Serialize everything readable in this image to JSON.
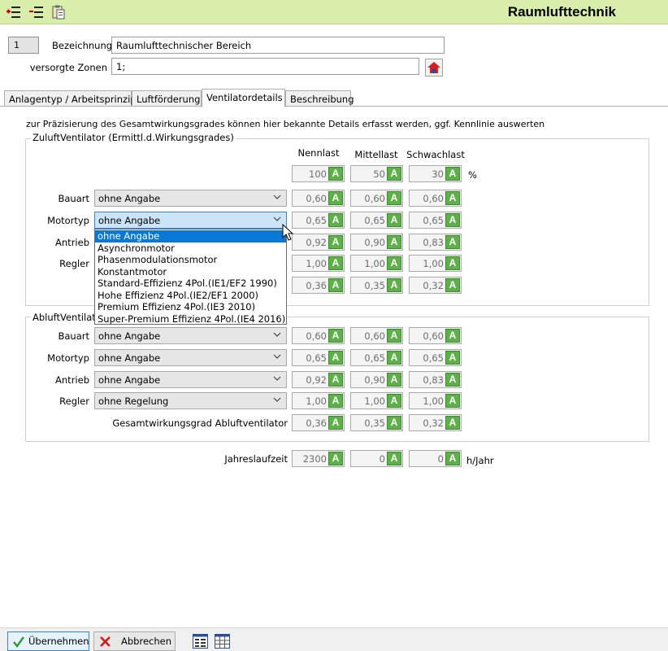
{
  "header": {
    "title": "Raumlufttechnik",
    "icons": [
      "add-row-icon",
      "remove-row-icon",
      "clipboard-icon"
    ]
  },
  "record": {
    "id": "1",
    "bezeichnung_label": "Bezeichnung",
    "bezeichnung_value": "Raumlufttechnischer Bereich",
    "zonen_label": "versorgte Zonen",
    "zonen_value": "1;"
  },
  "tabs": [
    {
      "label": "Anlagentyp / Arbeitsprinzip",
      "active": false
    },
    {
      "label": "Luftförderung",
      "active": false
    },
    {
      "label": "Ventilatordetails",
      "active": true
    },
    {
      "label": "Beschreibung",
      "active": false
    }
  ],
  "intro": "zur Präzisierung des Gesamtwirkungsgrades können hier bekannte Details erfasst werden, ggf. Kennlinie auswerten",
  "columns": {
    "nennlast": "Nennlast",
    "mittellast": "Mittellast",
    "schwachlast": "Schwachlast"
  },
  "zuluft": {
    "title": "ZuluftVentilator (Ermittl.d.Wirkungsgrades)",
    "load": {
      "values": [
        "100",
        "50",
        "30"
      ],
      "unit": "%"
    },
    "rows": [
      {
        "label": "Bauart",
        "select": "ohne Angabe",
        "values": [
          "0,60",
          "0,60",
          "0,60"
        ]
      },
      {
        "label": "Motortyp",
        "select": "ohne Angabe",
        "values": [
          "0,65",
          "0,65",
          "0,65"
        ]
      },
      {
        "label": "Antrieb",
        "values": [
          "0,92",
          "0,90",
          "0,83"
        ]
      },
      {
        "label": "Regler",
        "values": [
          "1,00",
          "1,00",
          "1,00"
        ]
      },
      {
        "values": [
          "0,36",
          "0,35",
          "0,32"
        ]
      }
    ]
  },
  "dropdown": {
    "options": [
      "ohne Angabe",
      "Asynchronmotor",
      "Phasenmodulationsmotor",
      "Konstantmotor",
      "Standard-Effizienz 4Pol.(IE1/EF2 1990)",
      "Hohe Effizienz 4Pol.(IE2/EF1 2000)",
      "Premium Effizienz 4Pol.(IE3 2010)",
      "Super-Premium Effizienz 4Pol.(IE4 2016)"
    ],
    "selected_index": 0
  },
  "abluft": {
    "title_visible": "AbluftVentilato",
    "rows": [
      {
        "label": "Bauart",
        "select": "ohne Angabe",
        "values": [
          "0,60",
          "0,60",
          "0,60"
        ]
      },
      {
        "label": "Motortyp",
        "select": "ohne Angabe",
        "values": [
          "0,65",
          "0,65",
          "0,65"
        ]
      },
      {
        "label": "Antrieb",
        "select": "ohne Angabe",
        "values": [
          "0,92",
          "0,90",
          "0,83"
        ]
      },
      {
        "label": "Regler",
        "select": "ohne Regelung",
        "values": [
          "1,00",
          "1,00",
          "1,00"
        ]
      },
      {
        "label": "Gesamtwirkungsgrad Abluftventilator",
        "values": [
          "0,36",
          "0,35",
          "0,32"
        ]
      }
    ]
  },
  "jahres": {
    "label": "Jahreslaufzeit",
    "values": [
      "2300",
      "0",
      "0"
    ],
    "unit": "h/Jahr"
  },
  "auto_button_label": "A",
  "footer": {
    "ok_label": "Übernehmen",
    "cancel_label": "Abbrechen"
  },
  "colors": {
    "header_bg": "#d8eeaa",
    "auto_button": "#5fb04a",
    "selection": "#0a78d7"
  }
}
